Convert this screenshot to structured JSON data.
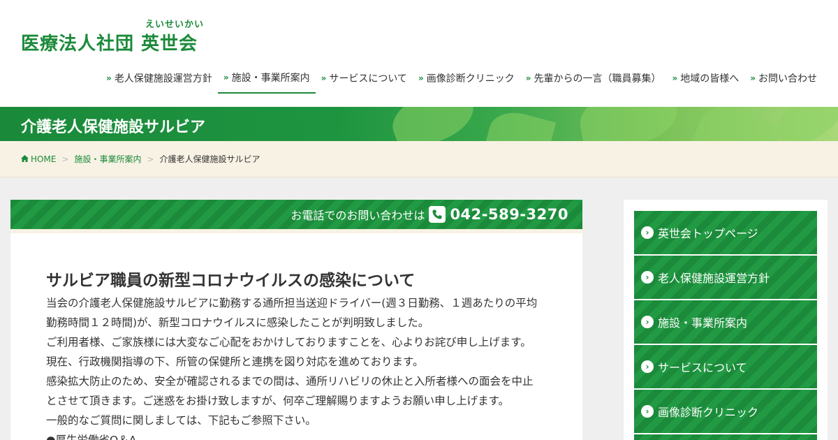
{
  "header": {
    "logo_ruby": "えいせいかい",
    "logo_text": "医療法人社団 英世会"
  },
  "nav": {
    "items": [
      {
        "label": "老人保健施設運営方針",
        "active": false
      },
      {
        "label": "施設・事業所案内",
        "active": true
      },
      {
        "label": "サービスについて",
        "active": false
      },
      {
        "label": "画像診断クリニック",
        "active": false
      },
      {
        "label": "先輩からの一言（職員募集）",
        "active": false
      },
      {
        "label": "地域の皆様へ",
        "active": false
      },
      {
        "label": "お問い合わせ",
        "active": false
      }
    ]
  },
  "page_title": "介護老人保健施設サルビア",
  "breadcrumb": {
    "home": "HOME",
    "parent": "施設・事業所案内",
    "current": "介護老人保健施設サルビア"
  },
  "phone": {
    "label": "お電話でのお問い合わせは",
    "number": "042-589-3270"
  },
  "article": {
    "title": "サルビア職員の新型コロナウイルスの感染について",
    "lines": [
      "当会の介護老人保健施設サルビアに勤務する通所担当送迎ドライバー(週３日勤務、１週あたりの平均",
      "勤務時間１２時間)が、新型コロナウイルスに感染したことが判明致しました。",
      "ご利用者様、ご家族様には大変なご心配をおかけしておりますことを、心よりお詫び申し上げます。",
      "現在、行政機関指導の下、所管の保健所と連携を図り対応を進めております。",
      "感染拡大防止のため、安全が確認されるまでの間は、通所リハビリの休止と入所者様への面会を中止",
      "とさせて頂きます。ご迷惑をお掛け致しますが、何卒ご理解賜りますようお願い申し上げます。",
      "一般的なご質問に関しましては、下記もご参照下さい。",
      "●厚生労働省Q＆A"
    ]
  },
  "sidebar": {
    "items": [
      "英世会トップページ",
      "老人保健施設運営方針",
      "施設・事業所案内",
      "サービスについて",
      "画像診断クリニック",
      ""
    ]
  },
  "colors": {
    "brand_green": "#1b8a3a",
    "breadcrumb_bg": "#f8f2e4",
    "page_bg": "#efefef"
  }
}
